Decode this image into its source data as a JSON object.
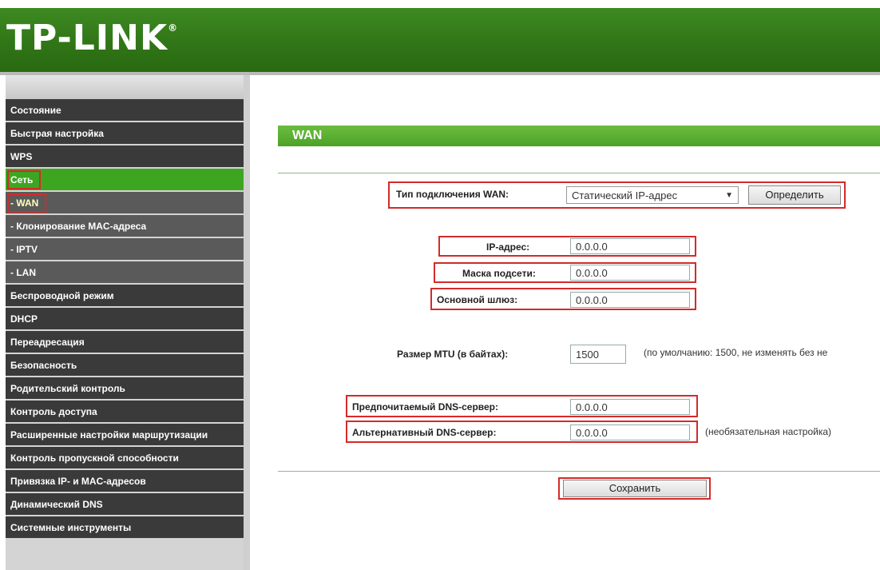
{
  "header": {
    "logo": "TP-LINK",
    "logo_mark": "®"
  },
  "sidebar": {
    "items": [
      {
        "label": "Состояние",
        "type": "main"
      },
      {
        "label": "Быстрая настройка",
        "type": "main"
      },
      {
        "label": "WPS",
        "type": "main"
      },
      {
        "label": "Сеть",
        "type": "active"
      },
      {
        "label": "- WAN",
        "type": "sub-boxed"
      },
      {
        "label": "- Клонирование MAC-адреса",
        "type": "sub"
      },
      {
        "label": "- IPTV",
        "type": "sub"
      },
      {
        "label": "- LAN",
        "type": "sub"
      },
      {
        "label": "Беспроводной режим",
        "type": "main"
      },
      {
        "label": "DHCP",
        "type": "main"
      },
      {
        "label": "Переадресация",
        "type": "main"
      },
      {
        "label": "Безопасность",
        "type": "main"
      },
      {
        "label": "Родительский контроль",
        "type": "main"
      },
      {
        "label": "Контроль доступа",
        "type": "main"
      },
      {
        "label": "Расширенные настройки маршрутизации",
        "type": "main"
      },
      {
        "label": "Контроль пропускной способности",
        "type": "main"
      },
      {
        "label": "Привязка IP- и MAC-адресов",
        "type": "main"
      },
      {
        "label": "Динамический DNS",
        "type": "main"
      },
      {
        "label": "Системные инструменты",
        "type": "main"
      }
    ]
  },
  "main": {
    "title": "WAN",
    "wan_type_label": "Тип подключения WAN:",
    "wan_type_value": "Статический IP-адрес",
    "detect_button": "Определить",
    "ip_label": "IP-адрес:",
    "ip_value": "0.0.0.0",
    "mask_label": "Маска подсети:",
    "mask_value": "0.0.0.0",
    "gateway_label": "Основной шлюз:",
    "gateway_value": "0.0.0.0",
    "mtu_label": "Размер MTU (в байтах):",
    "mtu_value": "1500",
    "mtu_note": "(по умолчанию: 1500, не изменять без не",
    "dns1_label": "Предпочитаемый DNS-сервер:",
    "dns1_value": "0.0.0.0",
    "dns2_label": "Альтернативный DNS-сервер:",
    "dns2_value": "0.0.0.0",
    "dns2_note": "(необязательная настройка)",
    "save_button": "Сохранить"
  },
  "colors": {
    "header_green": "#2f7416",
    "active_green": "#3ea521",
    "menu_dark": "#3a3a3a",
    "highlight_red": "#d42a2a"
  }
}
